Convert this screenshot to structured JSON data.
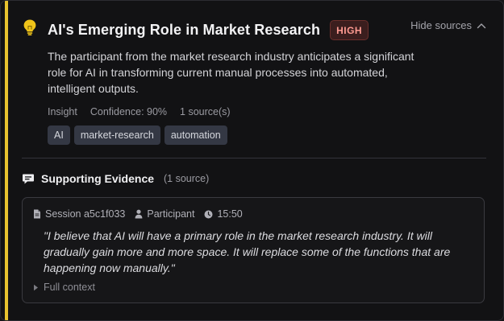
{
  "insight": {
    "title": "AI's Emerging Role in Market Research",
    "priority": "HIGH",
    "description": "The participant from the market research industry anticipates a significant role for AI in transforming current manual processes into automated, intelligent outputs.",
    "type": "Insight",
    "confidence": "Confidence: 90%",
    "source_count": "1 source(s)",
    "tags": [
      "AI",
      "market-research",
      "automation"
    ],
    "hide_sources_label": "Hide sources",
    "accent_color": "#e8c22e"
  },
  "evidence": {
    "title": "Supporting Evidence",
    "count": "(1 source)",
    "session": "Session a5c1f033",
    "speaker": "Participant",
    "time": "15:50",
    "quote": "\"I believe that AI will have a primary role in the market research industry. It will gradually gain more and more space. It will replace some of the functions that are happening now manually.\"",
    "full_context_label": "Full context"
  },
  "icons": {
    "bulb": "lightbulb-icon",
    "chevron": "chevron-up-icon",
    "comment": "comment-icon",
    "document": "document-icon",
    "user": "user-icon",
    "clock": "clock-icon",
    "caret": "caret-right-icon"
  }
}
